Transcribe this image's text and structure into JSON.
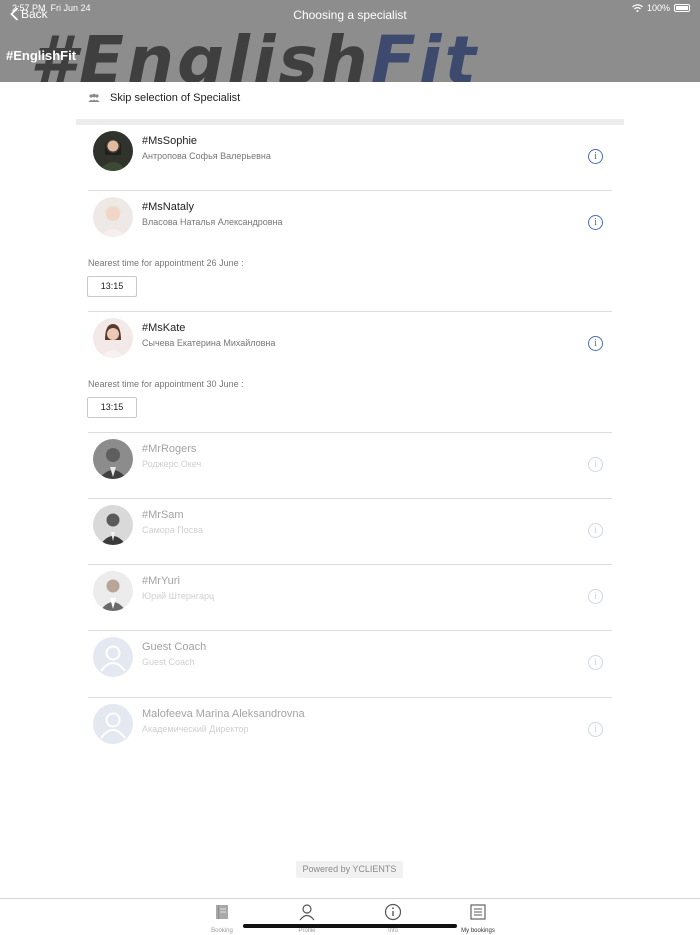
{
  "status_bar": {
    "time": "2:57 PM",
    "date": "Fri Jun 24",
    "battery": "100%"
  },
  "nav": {
    "back_label": "Back",
    "title": "Choosing a specialist",
    "brand": "#EnglishFit"
  },
  "banner": {
    "part1": "#English",
    "part2": "Fit"
  },
  "skip": {
    "label": "Skip selection of Specialist",
    "icon": "group-icon"
  },
  "specialists": [
    {
      "nickname": "#MsSophie",
      "full_name": "Антропова Софья Валерьевна",
      "available": true
    },
    {
      "nickname": "#MsNataly",
      "full_name": "Власова Наталья Александровна",
      "available": true,
      "nearest_label": "Nearest time for appointment 26 June :",
      "slot": "13:15"
    },
    {
      "nickname": "#MsKate",
      "full_name": "Сычева Екатерина Михайловна",
      "available": true,
      "nearest_label": "Nearest time for appointment 30 June :",
      "slot": "13:15"
    },
    {
      "nickname": "#MrRogers",
      "full_name": "Роджерс Океч",
      "available": false
    },
    {
      "nickname": "#MrSam",
      "full_name": "Самора Посва",
      "available": false
    },
    {
      "nickname": "#MrYuri",
      "full_name": "Юрий Штернгарц",
      "available": false
    },
    {
      "nickname": "Guest Coach",
      "full_name": "Guest Coach",
      "available": false
    },
    {
      "nickname": "Malofeeva Marina Aleksandrovna",
      "full_name": "Академический Директор",
      "available": false
    }
  ],
  "info_icon_glyph": "i",
  "powered_by": "Powered by YCLIENTS",
  "tabs": [
    {
      "label": "Booking",
      "icon": "book-icon"
    },
    {
      "label": "Profile",
      "icon": "user-icon"
    },
    {
      "label": "Info",
      "icon": "info-icon"
    },
    {
      "label": "My bookings",
      "icon": "list-icon"
    }
  ],
  "colors": {
    "header": "#8d8d8d",
    "accent": "#4a6dbf"
  }
}
